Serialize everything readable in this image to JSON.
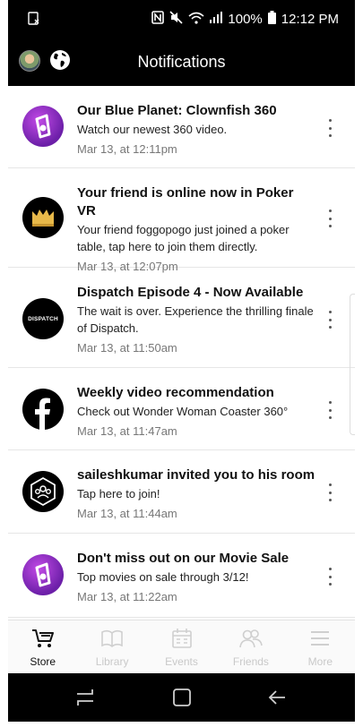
{
  "status_bar": {
    "battery": "100%",
    "time": "12:12 PM",
    "icons": [
      "sim-icon",
      "nfc-icon",
      "mute-icon",
      "wifi-icon",
      "signal-icon",
      "battery-icon"
    ]
  },
  "header": {
    "title": "Notifications"
  },
  "notifications": [
    {
      "icon": "oculus-icon",
      "title": "Our Blue Planet: Clownfish 360",
      "text": "Watch our newest 360 video.",
      "time": "Mar 13, at 12:11pm"
    },
    {
      "icon": "crown-icon",
      "title": "Your friend is online now in Poker VR",
      "text": "Your friend foggopogo just joined a poker table, tap here to join them directly.",
      "time": "Mar 13, at 12:07pm"
    },
    {
      "icon": "dispatch-icon",
      "icon_text": "DISPATCH",
      "title": "Dispatch Episode 4 - Now Available",
      "text": "The wait is over. Experience the thrilling finale of Dispatch.",
      "time": "Mar 13, at 11:50am"
    },
    {
      "icon": "facebook-icon",
      "title": "Weekly video recommendation",
      "text": "Check out Wonder Woman Coaster 360°",
      "time": "Mar 13, at 11:47am"
    },
    {
      "icon": "party-icon",
      "title": "saileshkumar invited you to his room",
      "text": "Tap here to join!",
      "time": "Mar 13, at 11:44am"
    },
    {
      "icon": "oculus-icon",
      "title": "Don't miss out on our Movie Sale",
      "text": "Top movies on sale through 3/12!",
      "time": "Mar 13, at 11:22am"
    }
  ],
  "tabs": [
    {
      "label": "Store",
      "icon": "cart-icon",
      "active": true
    },
    {
      "label": "Library",
      "icon": "book-icon",
      "active": false
    },
    {
      "label": "Events",
      "icon": "calendar-icon",
      "active": false
    },
    {
      "label": "Friends",
      "icon": "friends-icon",
      "active": false
    },
    {
      "label": "More",
      "icon": "menu-icon",
      "active": false
    }
  ],
  "colors": {
    "bar_background": "#000000",
    "oculus_purple": "#8a2bd2",
    "active_tab": "#111111",
    "inactive_tab": "#c9c9c9"
  }
}
